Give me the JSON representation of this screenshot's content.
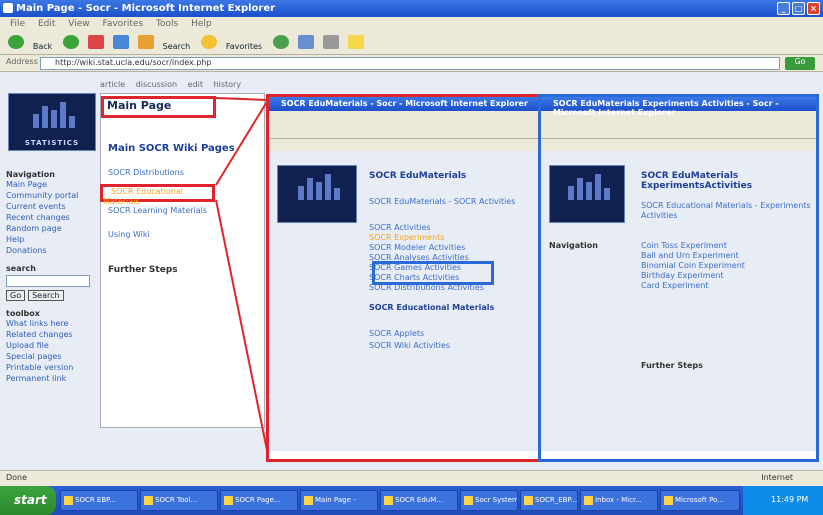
{
  "window": {
    "title": "Main Page - Socr - Microsoft Internet Explorer",
    "minimize": "_",
    "maximize": "□",
    "close": "×"
  },
  "menu": [
    "File",
    "Edit",
    "View",
    "Favorites",
    "Tools",
    "Help"
  ],
  "toolbar": {
    "back": "Back",
    "search": "Search",
    "favorites": "Favorites"
  },
  "address": {
    "label": "Address",
    "url": "http://wiki.stat.ucla.edu/socr/index.php",
    "go": "Go"
  },
  "page_tabs": [
    "article",
    "discussion",
    "edit",
    "history"
  ],
  "main": {
    "title": "Main Page",
    "heading": "Main SOCR Wiki Pages",
    "links": [
      "SOCR Distributions",
      "SOCR Educational Materials",
      "SOCR Learning Materials",
      "Using Wiki"
    ],
    "section": "Further Steps"
  },
  "left": {
    "logo": "STATISTICS",
    "nav_title": "Navigation",
    "nav": [
      "Main Page",
      "Community portal",
      "Current events",
      "Recent changes",
      "Random page",
      "Help",
      "Donations"
    ],
    "search_title": "search",
    "go_btn": "Go",
    "search_btn": "Search",
    "toolbox_title": "toolbox",
    "tools": [
      "What links here",
      "Related changes",
      "Upload file",
      "Special pages",
      "Printable version",
      "Permanent link"
    ]
  },
  "win2": {
    "title": "SOCR EduMaterials - Socr - Microsoft Internet Explorer",
    "heading": "SOCR EduMaterials",
    "sub": "SOCR EduMaterials - SOCR Activities",
    "links": [
      "SOCR Activities",
      "SOCR Experiments",
      "SOCR Modeler Activities",
      "SOCR Analyses Activities",
      "SOCR Games Activities",
      "SOCR Charts Activities",
      "SOCR Distributions Activities"
    ],
    "section": "SOCR Educational Materials",
    "links2": [
      "SOCR Applets",
      "SOCR Wiki Activities"
    ]
  },
  "win3": {
    "title": "SOCR EduMaterials Experiments Activities - Socr - Microsoft Internet Explorer",
    "heading": "SOCR EduMaterials ExperimentsActivities",
    "sub": "SOCR Educational Materials - Experiments Activities",
    "links": [
      "Coin Toss Experiment",
      "Ball and Urn Experiment",
      "Binomial Coin Experiment",
      "Birthday Experiment",
      "Card Experiment"
    ],
    "section": "Navigation",
    "section2": "Further Steps"
  },
  "status": {
    "text": "Done",
    "zone": "Internet"
  },
  "taskbar": {
    "start": "start",
    "tasks": [
      "SOCR EBP...",
      "SOCR Tool...",
      "SOCR Page...",
      "Main Page -",
      "SOCR EduM...",
      "Socr System",
      "SOCR_EBP...",
      "Inbox - Micr...",
      "Microsoft Po..."
    ],
    "clock": "11:49 PM"
  }
}
